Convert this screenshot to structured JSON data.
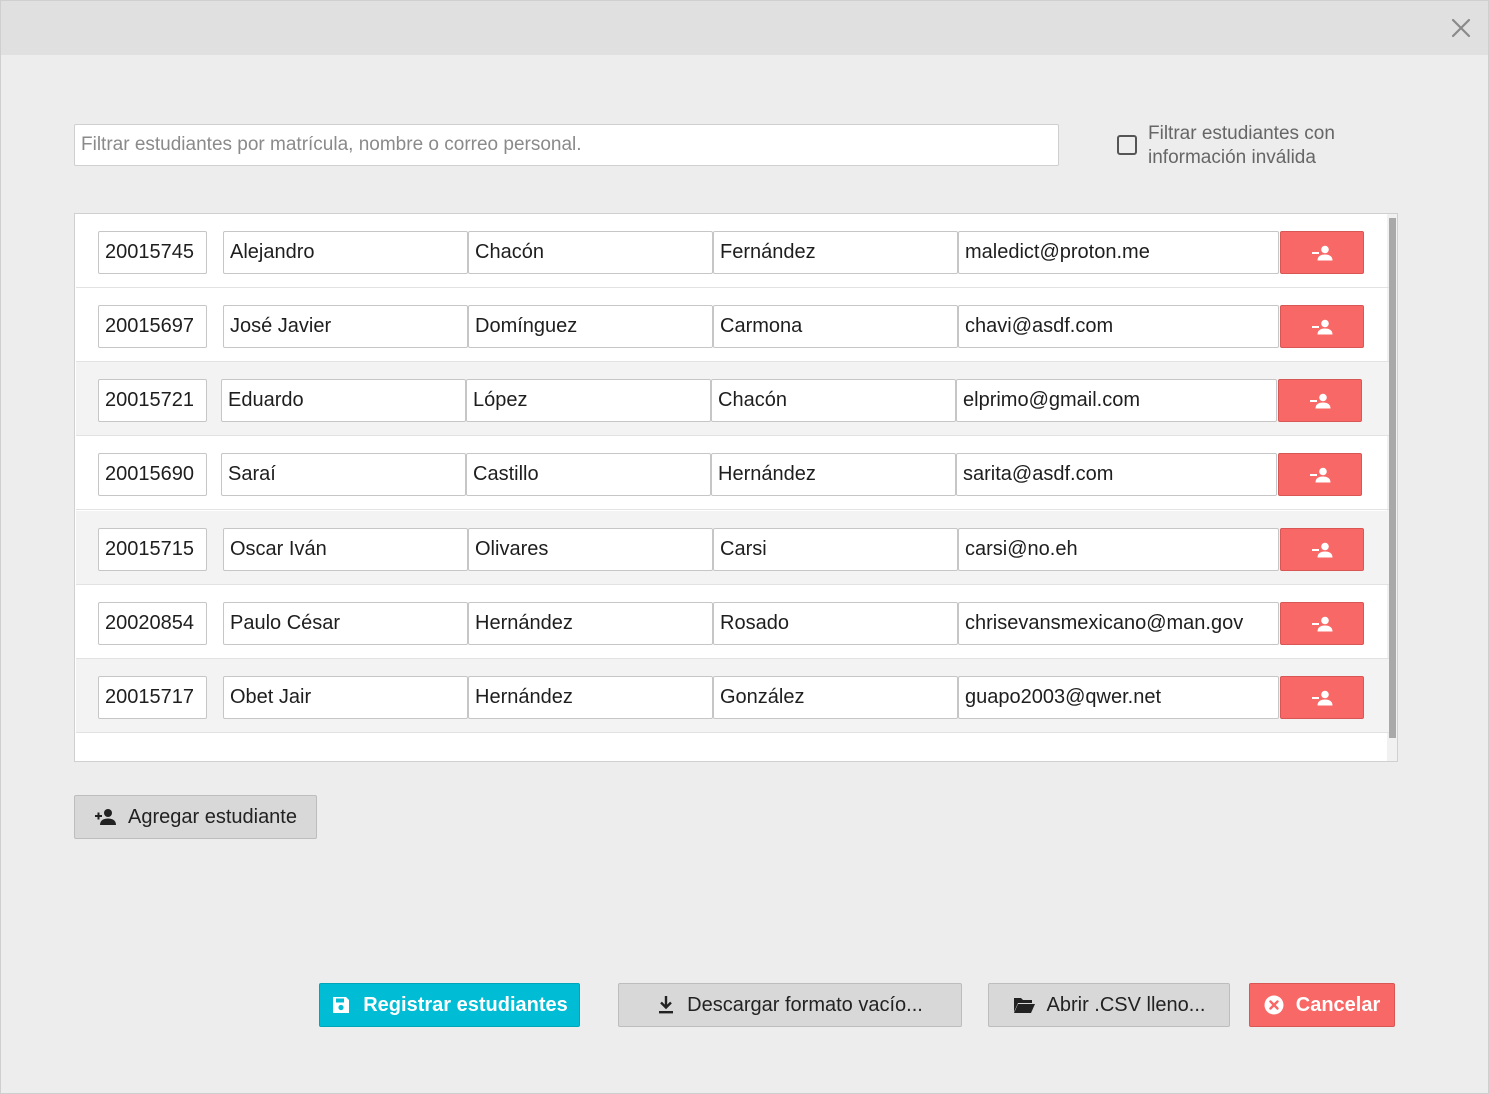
{
  "dialog": {
    "close_icon": "close-icon"
  },
  "filter": {
    "placeholder": "Filtrar estudiantes por matrícula, nombre o correo personal.",
    "value": "",
    "invalid_checkbox_label": "Filtrar estudiantes con información inválida",
    "invalid_checkbox_checked": false
  },
  "students": [
    {
      "matricula": "20015745",
      "nombre": "Alejandro",
      "apellido_paterno": "Chacón",
      "apellido_materno": "Fernández",
      "correo": "maledict@proton.me"
    },
    {
      "matricula": "20015697",
      "nombre": "José Javier",
      "apellido_paterno": "Domínguez",
      "apellido_materno": "Carmona",
      "correo": "chavi@asdf.com"
    },
    {
      "matricula": "20015721",
      "nombre": "Eduardo",
      "apellido_paterno": "López",
      "apellido_materno": "Chacón",
      "correo": "elprimo@gmail.com"
    },
    {
      "matricula": "20015690",
      "nombre": "Saraí",
      "apellido_paterno": "Castillo",
      "apellido_materno": "Hernández",
      "correo": "sarita@asdf.com"
    },
    {
      "matricula": "20015715",
      "nombre": "Oscar Iván",
      "apellido_paterno": "Olivares",
      "apellido_materno": "Carsi",
      "correo": "carsi@no.eh"
    },
    {
      "matricula": "20020854",
      "nombre": "Paulo César",
      "apellido_paterno": "Hernández",
      "apellido_materno": "Rosado",
      "correo": "chrisevansmexicano@man.gov"
    },
    {
      "matricula": "20015717",
      "nombre": "Obet Jair",
      "apellido_paterno": "Hernández",
      "apellido_materno": "González",
      "correo": "guapo2003@qwer.net"
    }
  ],
  "buttons": {
    "add_student": "Agregar estudiante",
    "register": "Registrar estudiantes",
    "download_template": "Descargar formato vacío...",
    "open_csv": "Abrir .CSV lleno...",
    "cancel": "Cancelar"
  },
  "icons": {
    "remove_row": "person-remove-icon",
    "add_student": "person-add-icon",
    "register": "save-icon",
    "download": "download-icon",
    "open": "folder-open-icon",
    "cancel": "cancel-circle-icon"
  },
  "colors": {
    "accent": "#00bcd4",
    "danger": "#f86866",
    "neutral_button": "#d8d8d8",
    "background": "#ededed"
  }
}
